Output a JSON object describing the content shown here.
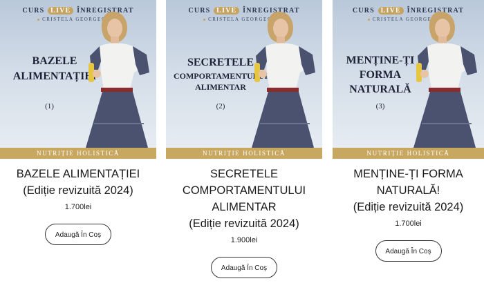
{
  "cover_common": {
    "top_left": "CURS",
    "live": "LIVE",
    "top_right": "ÎNREGISTRAT",
    "author": "CRISTELA GEORGESCU",
    "band": "NUTRIȚIE HOLISTICĂ"
  },
  "products": [
    {
      "cover_title": [
        "BAZELE",
        "ALIMENTAȚIEI"
      ],
      "cover_number": "(1)",
      "name_lines": [
        "BAZELE ALIMENTAȚIEI",
        "(Ediție revizuită 2024)"
      ],
      "price": "1.700lei",
      "button": "Adaugă În Coș"
    },
    {
      "cover_title": [
        "SECRETELE",
        "COMPORTAMENTULUI",
        "ALIMENTAR"
      ],
      "cover_number": "(2)",
      "name_lines": [
        "SECRETELE",
        "COMPORTAMENTULUI",
        "ALIMENTAR",
        "(Ediție revizuită 2024)"
      ],
      "price": "1.900lei",
      "button": "Adaugă În Coș"
    },
    {
      "cover_title": [
        "MENȚINE-ȚI",
        "FORMA",
        "NATURALĂ"
      ],
      "cover_number": "(3)",
      "name_lines": [
        "MENȚINE-ȚI FORMA",
        "NATURALĂ!",
        "(Ediție revizuită 2024)"
      ],
      "price": "1.700lei",
      "button": "Adaugă În Coș"
    }
  ],
  "colors": {
    "gold": "#c8a860",
    "navy": "#1d2236",
    "dress": "#4a5270"
  }
}
